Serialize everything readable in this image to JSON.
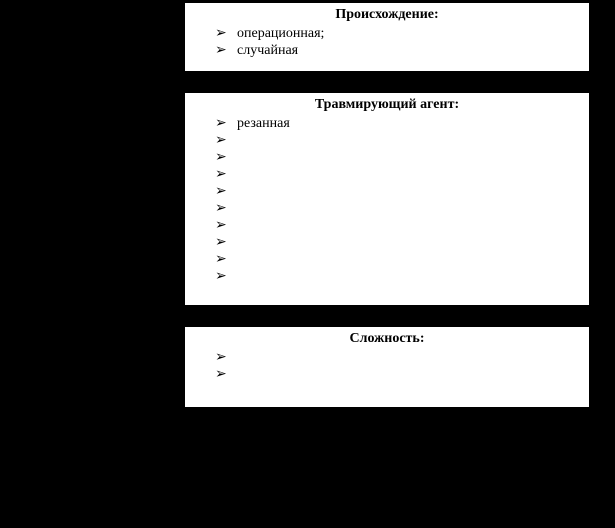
{
  "boxes": [
    {
      "id": "origin",
      "title": "Происхождение:",
      "items": [
        "операционная;",
        "случайная"
      ]
    },
    {
      "id": "agent",
      "title": "Травмирующий агент:",
      "items": [
        "резанная",
        "",
        "",
        "",
        "",
        "",
        "",
        "",
        "",
        ""
      ]
    },
    {
      "id": "complexity",
      "title": "Сложность:",
      "items": [
        "",
        ""
      ]
    }
  ]
}
